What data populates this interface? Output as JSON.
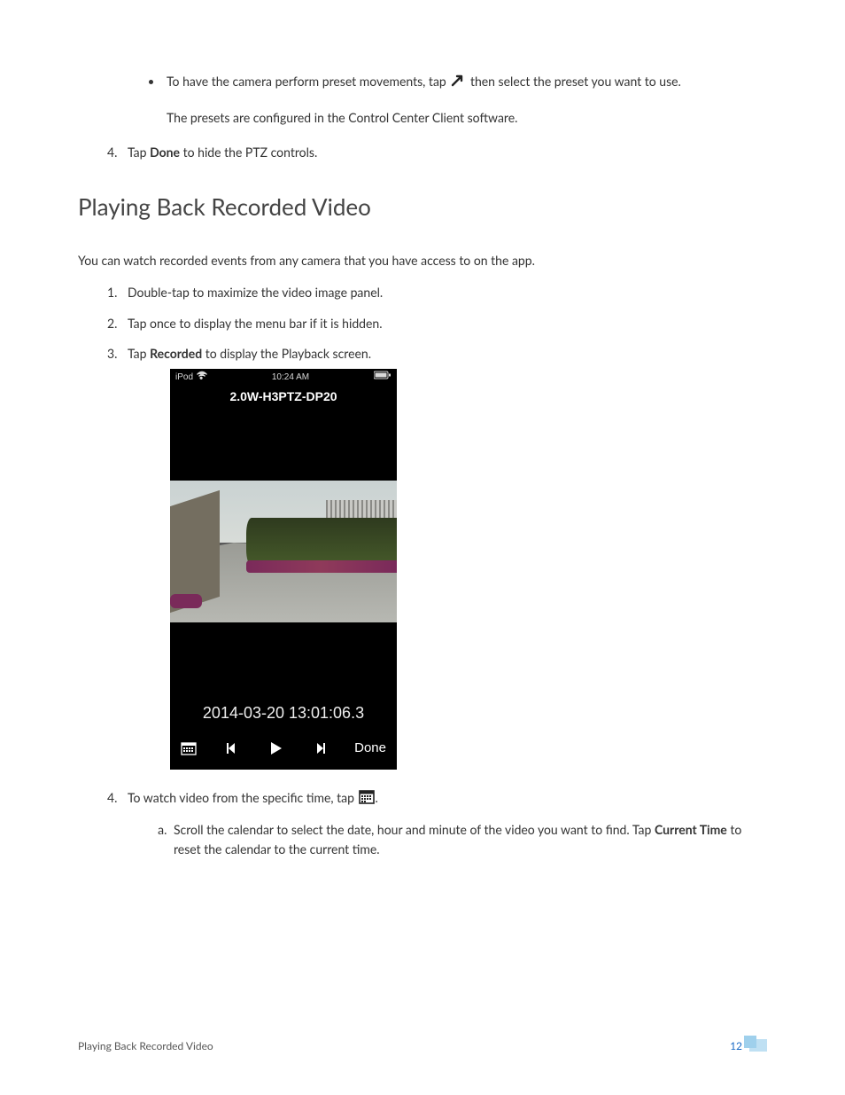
{
  "intro_bullet": {
    "text_before": "To have the camera perform preset movements, tap ",
    "text_after": " then select the preset you want to use.",
    "sub_text": "The presets are configured in the Control Center Client software."
  },
  "step_done": {
    "prefix": "Tap ",
    "bold": "Done",
    "suffix": " to hide the PTZ controls."
  },
  "heading": "Playing Back Recorded Video",
  "intro_para": "You can watch recorded events from any camera that you have access to on the app.",
  "steps": {
    "s1": "Double-tap to maximize the video image panel.",
    "s2": "Tap once to display the menu bar if it is hidden.",
    "s3": {
      "prefix": "Tap ",
      "bold": "Recorded",
      "suffix": " to display the Playback screen."
    },
    "s4": {
      "prefix": "To watch video from the specific time, tap ",
      "suffix": "."
    },
    "s4a": {
      "prefix": "Scroll the calendar to select the date, hour and minute of the video you want to find. Tap ",
      "bold": "Current Time",
      "suffix": " to reset the calendar to the current time."
    }
  },
  "phone": {
    "status_left": "iPod",
    "status_time": "10:24 AM",
    "title": "2.0W-H3PTZ-DP20",
    "timestamp": "2014-03-20 13:01:06.3",
    "done": "Done"
  },
  "footer": {
    "left": "Playing Back Recorded Video",
    "page": "12"
  }
}
